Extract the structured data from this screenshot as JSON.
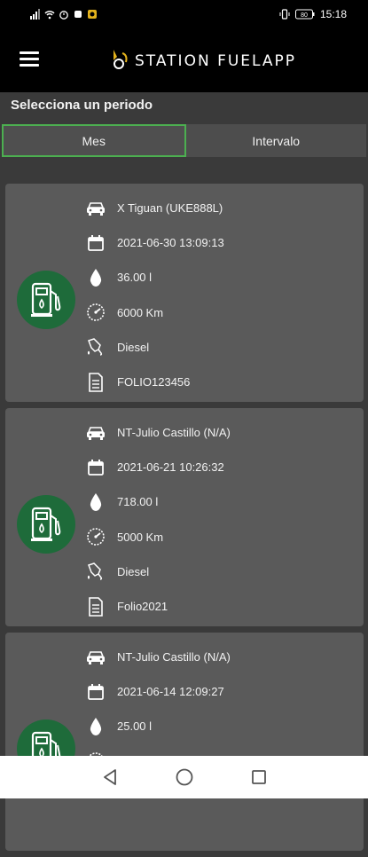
{
  "status": {
    "time": "15:18",
    "battery": "80"
  },
  "app": {
    "logo_text": "STATION FUELAPP"
  },
  "period": {
    "label": "Selecciona un periodo",
    "tabs": [
      {
        "label": "Mes"
      },
      {
        "label": "Intervalo"
      }
    ]
  },
  "records": [
    {
      "vehicle": "X Tiguan (UKE888L)",
      "date": "2021-06-30 13:09:13",
      "liters": "36.00 l",
      "odometer": "6000 Km",
      "fuel": "Diesel",
      "folio": "FOLIO123456"
    },
    {
      "vehicle": "NT-Julio Castillo (N/A)",
      "date": "2021-06-21 10:26:32",
      "liters": "718.00 l",
      "odometer": "5000 Km",
      "fuel": "Diesel",
      "folio": "Folio2021"
    },
    {
      "vehicle": "NT-Julio Castillo (N/A)",
      "date": "2021-06-14 12:09:27",
      "liters": "25.00 l",
      "odometer": "",
      "fuel": "",
      "folio": ""
    }
  ],
  "icons": {
    "vehicle": "car-icon",
    "date": "calendar-icon",
    "liters": "drop-icon",
    "odometer": "speedometer-icon",
    "fuel": "fuel-nozzle-icon",
    "folio": "document-icon",
    "avatar": "fuel-pump-icon"
  },
  "colors": {
    "accent": "#4caf50",
    "avatar_bg": "#1e6b3a",
    "card_bg": "#5a5a5a",
    "page_bg": "#3a3a3a"
  }
}
